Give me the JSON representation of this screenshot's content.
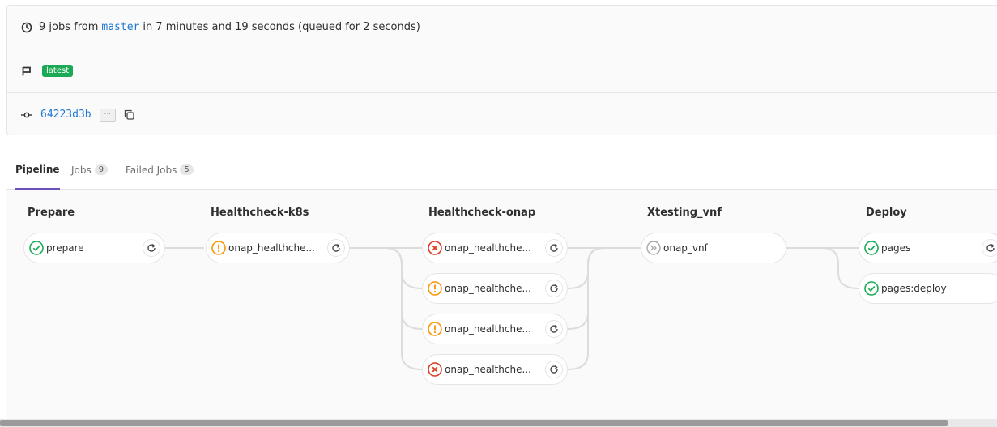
{
  "summary": {
    "prefix": "9 jobs from",
    "branch": "master",
    "suffix": "in 7 minutes and 19 seconds (queued for 2 seconds)"
  },
  "badges": {
    "latest": "latest"
  },
  "commit": {
    "sha": "64223d3b",
    "ellipsis": "···"
  },
  "tabs": {
    "pipeline": "Pipeline",
    "jobs": "Jobs",
    "jobs_count": "9",
    "failed": "Failed Jobs",
    "failed_count": "5"
  },
  "stages": [
    {
      "title": "Prepare",
      "jobs": [
        {
          "name": "prepare",
          "status": "success"
        }
      ]
    },
    {
      "title": "Healthcheck-k8s",
      "jobs": [
        {
          "name": "onap_healthche...",
          "status": "warning"
        }
      ]
    },
    {
      "title": "Healthcheck-onap",
      "jobs": [
        {
          "name": "onap_healthche...",
          "status": "failed"
        },
        {
          "name": "onap_healthche...",
          "status": "warning"
        },
        {
          "name": "onap_healthche...",
          "status": "warning"
        },
        {
          "name": "onap_healthche...",
          "status": "failed"
        }
      ]
    },
    {
      "title": "Xtesting_vnf",
      "jobs": [
        {
          "name": "onap_vnf",
          "status": "skipped"
        }
      ]
    },
    {
      "title": "Deploy",
      "jobs": [
        {
          "name": "pages",
          "status": "success"
        },
        {
          "name": "pages:deploy",
          "status": "success"
        }
      ]
    }
  ],
  "colors": {
    "success": "#1aaa55",
    "warning": "#fc9403",
    "failed": "#db3b21",
    "skipped": "#a7a7a7",
    "link": "#1f78d1",
    "tab_active": "#6b4fbb"
  },
  "icons": {
    "summary": "clock-icon",
    "ref": "flag-icon",
    "commit": "commit-icon",
    "copy": "copy-icon",
    "retry": "retry-icon"
  }
}
